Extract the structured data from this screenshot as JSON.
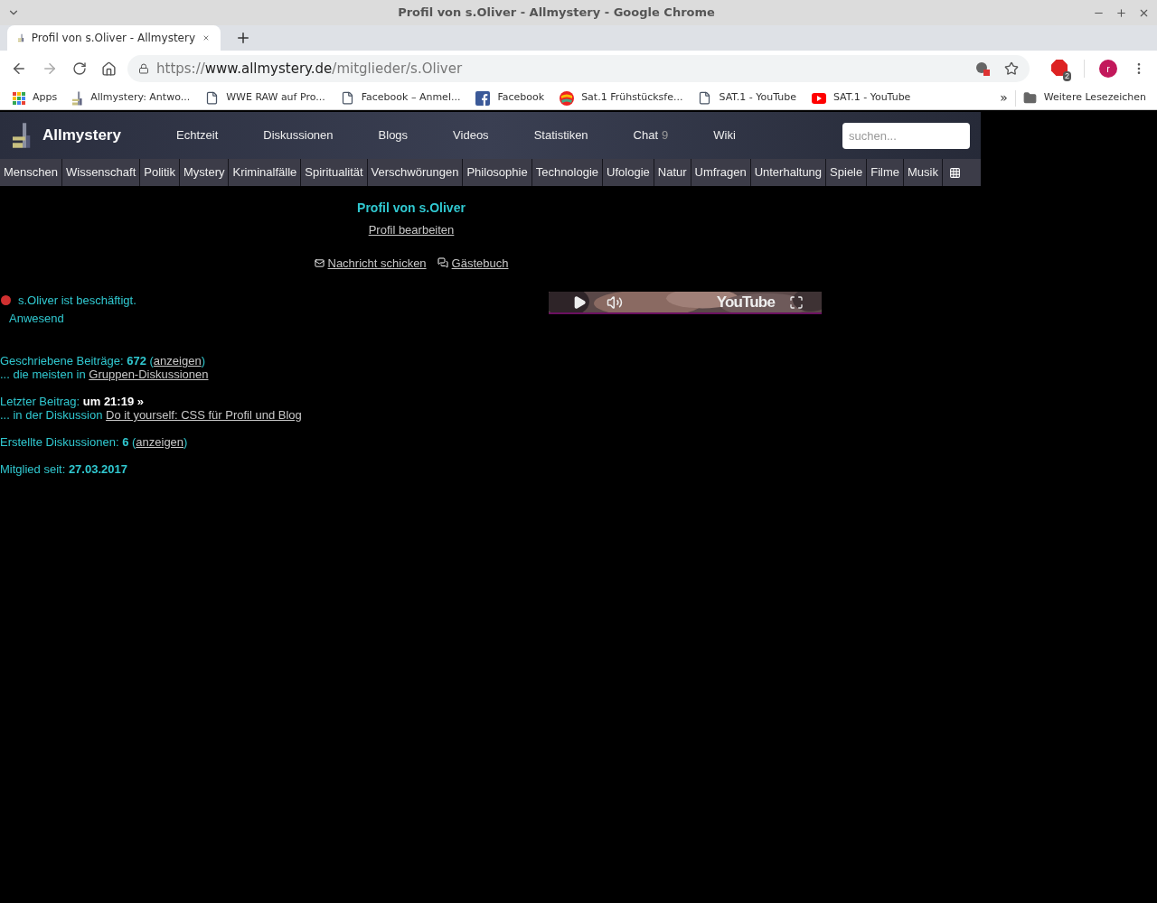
{
  "window": {
    "title": "Profil von s.Oliver - Allmystery - Google Chrome"
  },
  "tabs": [
    {
      "title": "Profil von s.Oliver - Allmystery",
      "selected": true
    }
  ],
  "address_bar": {
    "scheme": "https://",
    "host": "www.allmystery.de",
    "path": "/mitglieder/s.Oliver"
  },
  "extension_badge": "2",
  "profile_initial": "r",
  "bookmarks": [
    {
      "kind": "apps",
      "label": "Apps"
    },
    {
      "kind": "site",
      "label": "Allmystery: Antwo..."
    },
    {
      "kind": "page",
      "label": "WWE RAW auf Pro..."
    },
    {
      "kind": "page",
      "label": "Facebook – Anmel..."
    },
    {
      "kind": "facebook",
      "label": "Facebook"
    },
    {
      "kind": "sat1",
      "label": "Sat.1 Frühstücksfe..."
    },
    {
      "kind": "page",
      "label": "SAT.1 - YouTube"
    },
    {
      "kind": "youtube",
      "label": "SAT.1 - YouTube"
    }
  ],
  "bookmarks_overflow": "»",
  "other_bookmarks": "Weitere Lesezeichen",
  "site": {
    "logo": "Allmystery",
    "nav": [
      {
        "label": "Echtzeit"
      },
      {
        "label": "Diskussionen"
      },
      {
        "label": "Blogs"
      },
      {
        "label": "Videos"
      },
      {
        "label": "Statistiken"
      },
      {
        "label": "Chat",
        "count": "9"
      },
      {
        "label": "Wiki"
      }
    ],
    "search": {
      "placeholder": "suchen..."
    },
    "categories": [
      "Menschen",
      "Wissenschaft",
      "Politik",
      "Mystery",
      "Kriminalfälle",
      "Spiritualität",
      "Verschwörungen",
      "Philosophie",
      "Technologie",
      "Ufologie",
      "Natur",
      "Umfragen",
      "Unterhaltung",
      "Spiele",
      "Filme",
      "Musik"
    ]
  },
  "profile": {
    "title": "Profil von s.Oliver",
    "edit_link": "Profil bearbeiten",
    "actions": [
      {
        "kind": "message",
        "label": "Nachricht schicken"
      },
      {
        "kind": "guestbook",
        "label": "Gästebuch"
      }
    ],
    "status": {
      "color": "#d03030",
      "text": "s.Oliver ist beschäftigt.",
      "note": "Anwesend"
    },
    "video": {
      "logo": "YouTube"
    },
    "stats": [
      [
        {
          "text": "Geschriebene Beiträge: **672** (",
          "link": "anzeigen",
          "after": ")"
        },
        {
          "text": "... die meisten in ",
          "link": "Gruppen-Diskussionen"
        }
      ],
      [
        {
          "text": "Letzter Beitrag: ",
          "strong": "um 21:19 »"
        },
        {
          "text": "... in der Diskussion ",
          "link": "Do it yourself: CSS für Profil und Blog"
        }
      ],
      [
        {
          "text": "Erstellte Diskussionen: **6** (",
          "link": "anzeigen",
          "after": ")"
        }
      ],
      [
        {
          "text": "Mitglied seit: **27.03.2017**"
        }
      ]
    ]
  }
}
